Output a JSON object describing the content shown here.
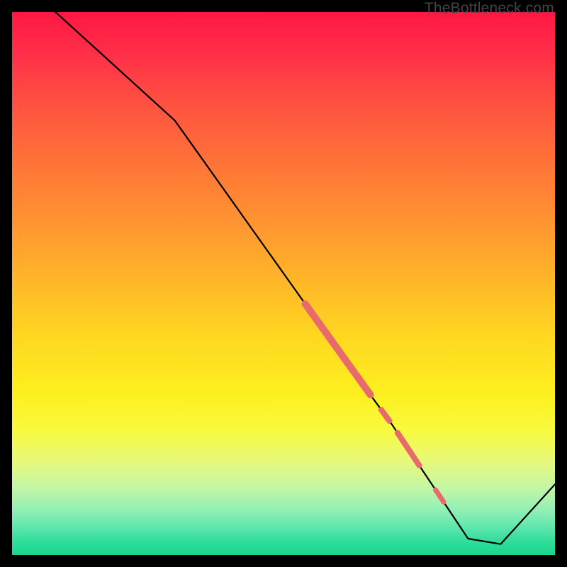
{
  "watermark": "TheBottleneck.com",
  "chart_data": {
    "type": "line",
    "title": "",
    "xlabel": "",
    "ylabel": "",
    "xlim": [
      0,
      100
    ],
    "ylim": [
      0,
      100
    ],
    "series": [
      {
        "name": "bottleneck-curve",
        "x": [
          0,
          8,
          30,
          62,
          70,
          78,
          84,
          90,
          100
        ],
        "values": [
          104,
          100,
          80,
          35,
          24,
          12,
          3,
          2,
          13
        ]
      }
    ],
    "highlights": [
      {
        "name": "segment-main",
        "x_start": 54,
        "x_end": 66,
        "thickness": 10
      },
      {
        "name": "dot-1",
        "x_start": 68,
        "x_end": 69.5,
        "thickness": 8
      },
      {
        "name": "segment-small",
        "x_start": 71,
        "x_end": 75,
        "thickness": 8
      },
      {
        "name": "dot-2",
        "x_start": 78,
        "x_end": 79.5,
        "thickness": 7
      }
    ],
    "highlight_color": "#e86a6a"
  }
}
